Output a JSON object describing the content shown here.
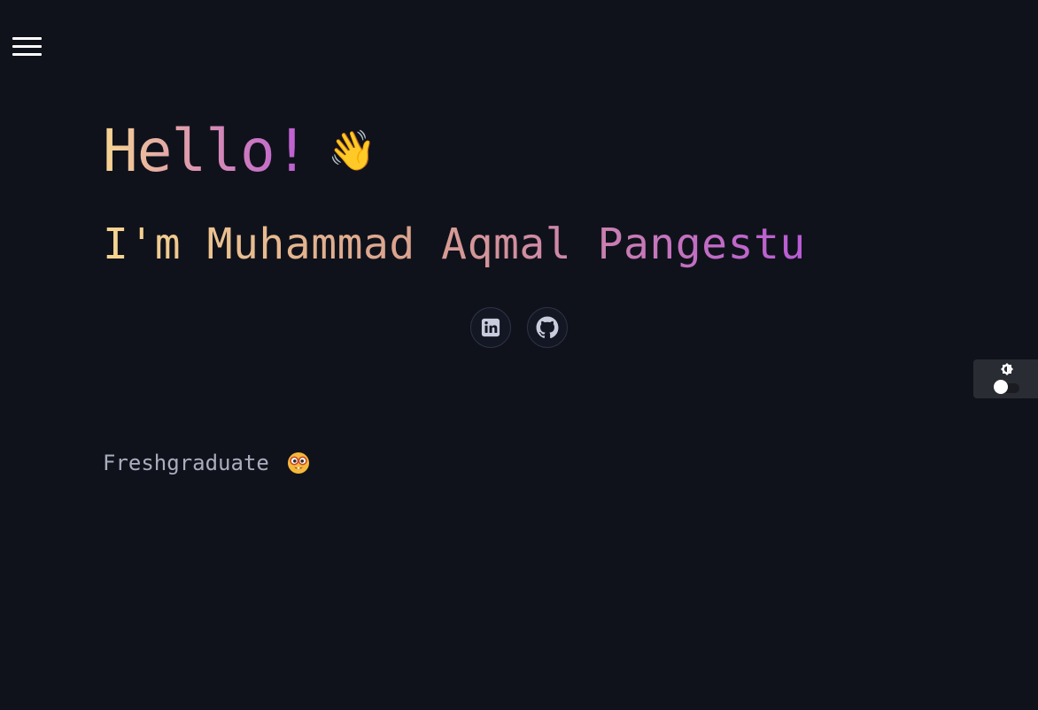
{
  "nav": {
    "menu_icon": "hamburger-menu-icon"
  },
  "hero": {
    "greeting": "Hello!",
    "greeting_emoji": "👋",
    "name_line": "I'm Muhammad Aqmal Pangestu"
  },
  "socials": {
    "items": [
      {
        "name": "LinkedIn",
        "icon": "linkedin-icon"
      },
      {
        "name": "GitHub",
        "icon": "github-icon"
      }
    ]
  },
  "tagline": {
    "text": "Freshgraduate",
    "emoji_icon": "nerd-face-emoji-icon"
  },
  "theme_toggle": {
    "icon": "brightness-icon",
    "state": "dark"
  },
  "colors": {
    "background": "#10121b",
    "gradient_start": "#f6d591",
    "gradient_end": "#b95bd6",
    "muted_text": "#a9adbd"
  }
}
